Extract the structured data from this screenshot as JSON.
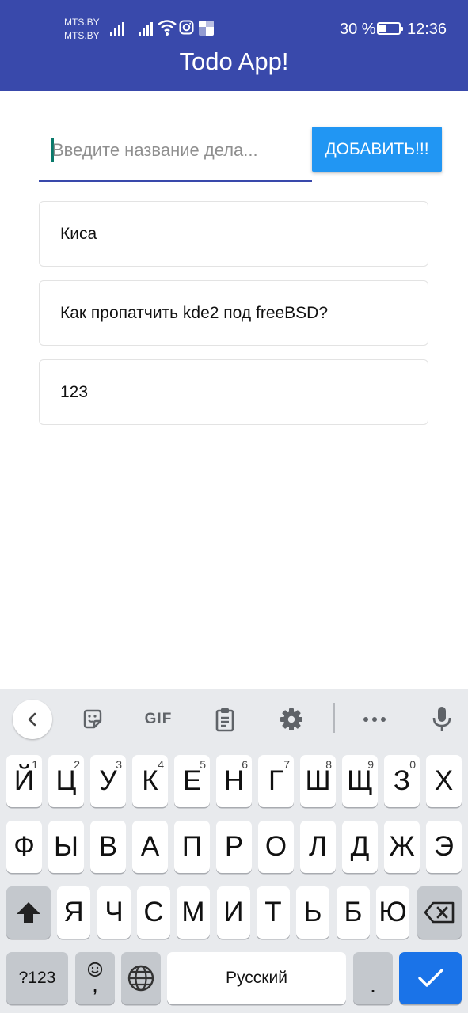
{
  "status_bar": {
    "carrier_1": "MTS.BY",
    "carrier_2": "MTS.BY",
    "battery_percent_text": "30 %",
    "battery_level": 0.3,
    "time": "12:36",
    "icons": [
      "signal-icon",
      "signal-icon",
      "wifi-icon",
      "instagram-icon",
      "app-notification-icon",
      "battery-icon"
    ]
  },
  "app": {
    "title": "Todo App!",
    "header_color": "#3949ab"
  },
  "new_todo": {
    "value": "",
    "placeholder": "Введите название дела...",
    "add_label": "ДОБАВИТЬ!!!",
    "button_color": "#2196f3"
  },
  "todos": [
    {
      "text": "Киса"
    },
    {
      "text": "Как пропатчить kde2 под freeBSD?"
    },
    {
      "text": "123"
    }
  ],
  "keyboard": {
    "toolbar": [
      "back-icon",
      "sticker-icon",
      "GIF",
      "clipboard-icon",
      "settings-icon",
      "more-icon",
      "microphone-icon"
    ],
    "gif_label": "GIF",
    "row1": [
      {
        "label": "Й",
        "hint": "1"
      },
      {
        "label": "Ц",
        "hint": "2"
      },
      {
        "label": "У",
        "hint": "3"
      },
      {
        "label": "К",
        "hint": "4"
      },
      {
        "label": "Е",
        "hint": "5"
      },
      {
        "label": "Н",
        "hint": "6"
      },
      {
        "label": "Г",
        "hint": "7"
      },
      {
        "label": "Ш",
        "hint": "8"
      },
      {
        "label": "Щ",
        "hint": "9"
      },
      {
        "label": "З",
        "hint": "0"
      },
      {
        "label": "Х",
        "hint": ""
      }
    ],
    "row2": [
      "Ф",
      "Ы",
      "В",
      "А",
      "П",
      "Р",
      "О",
      "Л",
      "Д",
      "Ж",
      "Э"
    ],
    "row3": [
      "Я",
      "Ч",
      "С",
      "М",
      "И",
      "Т",
      "Ь",
      "Б",
      "Ю"
    ],
    "symbols_label": "?123",
    "comma_label": ",",
    "space_label": "Русский",
    "period_label": ".",
    "accent_color": "#1a73e8"
  }
}
